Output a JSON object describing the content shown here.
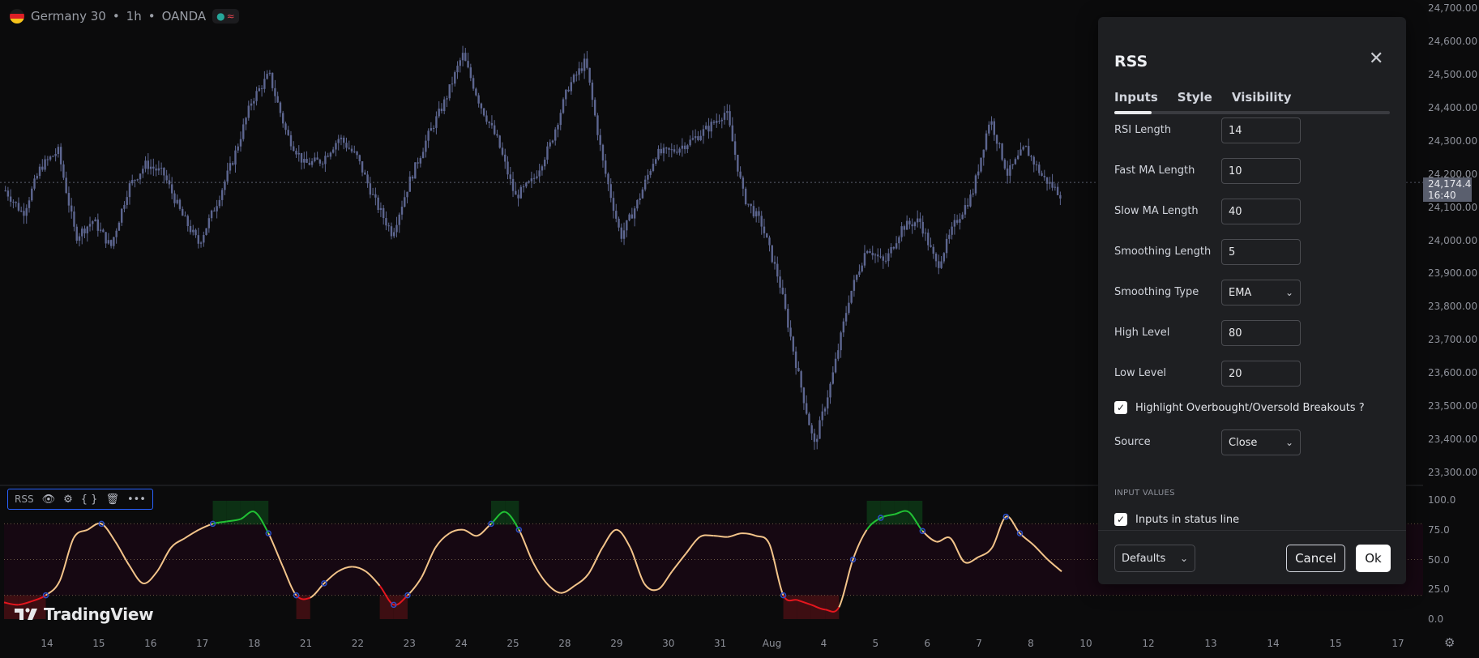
{
  "symbol": {
    "name": "Germany 30",
    "interval": "1h",
    "broker": "OANDA"
  },
  "indicator": {
    "short_name": "RSS"
  },
  "brand": {
    "text": "TradingView"
  },
  "price_axis": {
    "labels": [
      "24,700.00",
      "24,600.00",
      "24,500.00",
      "24,400.00",
      "24,300.00",
      "24,200.00",
      "24,100.00",
      "24,000.00",
      "23,900.00",
      "23,800.00",
      "23,700.00",
      "23,600.00",
      "23,500.00",
      "23,400.00",
      "23,300.00"
    ],
    "current_price": "24,174.4",
    "countdown": "16:40"
  },
  "osc_axis": {
    "labels": [
      "100.0",
      "75.0",
      "50.0",
      "25.0",
      "0.0"
    ]
  },
  "time_axis": {
    "labels": [
      "14",
      "15",
      "16",
      "17",
      "18",
      "21",
      "22",
      "23",
      "24",
      "25",
      "28",
      "29",
      "30",
      "31",
      "Aug",
      "4",
      "5",
      "6",
      "7",
      "8",
      "10",
      "12",
      "13",
      "14",
      "15",
      "17"
    ]
  },
  "dialog": {
    "title": "RSS",
    "tabs": [
      "Inputs",
      "Style",
      "Visibility"
    ],
    "active_tab": "Inputs",
    "fields": [
      {
        "label": "RSI Length",
        "value": "14",
        "type": "number"
      },
      {
        "label": "Fast MA Length",
        "value": "10",
        "type": "number"
      },
      {
        "label": "Slow MA Length",
        "value": "40",
        "type": "number"
      },
      {
        "label": "Smoothing Length",
        "value": "5",
        "type": "number"
      },
      {
        "label": "Smoothing Type",
        "value": "EMA",
        "type": "select"
      },
      {
        "label": "High Level",
        "value": "80",
        "type": "number"
      },
      {
        "label": "Low Level",
        "value": "20",
        "type": "number"
      }
    ],
    "highlight_checkbox": {
      "label": "Highlight Overbought/Oversold Breakouts ?",
      "checked": true
    },
    "source": {
      "label": "Source",
      "value": "Close"
    },
    "section_input_values": "INPUT VALUES",
    "status_line_checkbox": {
      "label": "Inputs in status line",
      "checked": true
    },
    "defaults_label": "Defaults",
    "cancel_label": "Cancel",
    "ok_label": "Ok"
  },
  "colors": {
    "background": "#0b0b0c",
    "candle": "#5d6690",
    "osc_line": "#f3c48a",
    "osc_overbought": "#21c234",
    "osc_oversold": "#e5161e",
    "zone_fill": "#160812"
  },
  "chart_data": {
    "type": "candlestick",
    "price_range": [
      23300,
      24700
    ],
    "close_path": [
      24150,
      24080,
      24220,
      24270,
      24010,
      24060,
      23980,
      24160,
      24230,
      24200,
      24080,
      23990,
      24110,
      24250,
      24420,
      24500,
      24320,
      24230,
      24240,
      24310,
      24250,
      24120,
      24020,
      24180,
      24310,
      24420,
      24560,
      24410,
      24300,
      24130,
      24180,
      24290,
      24460,
      24540,
      24230,
      24010,
      24120,
      24260,
      24270,
      24300,
      24340,
      24390,
      24130,
      24050,
      23880,
      23620,
      23380,
      23580,
      23830,
      23980,
      23930,
      24040,
      24060,
      23920,
      24050,
      24140,
      24370,
      24200,
      24280,
      24190,
      24140
    ],
    "osc_range": [
      0,
      100
    ],
    "osc_levels": {
      "high": 80,
      "low": 20
    },
    "osc_series": [
      14,
      12,
      15,
      20,
      32,
      68,
      75,
      80,
      65,
      45,
      30,
      40,
      60,
      68,
      75,
      80,
      82,
      84,
      90,
      72,
      45,
      20,
      18,
      30,
      40,
      44,
      40,
      28,
      12,
      20,
      35,
      60,
      72,
      75,
      70,
      80,
      90,
      75,
      48,
      30,
      22,
      28,
      38,
      60,
      75,
      60,
      30,
      25,
      40,
      55,
      69,
      70,
      69,
      72,
      70,
      63,
      20,
      16,
      12,
      8,
      10,
      50,
      75,
      85,
      88,
      90,
      74,
      65,
      68,
      48,
      52,
      60,
      86,
      72,
      62,
      50,
      40
    ]
  }
}
